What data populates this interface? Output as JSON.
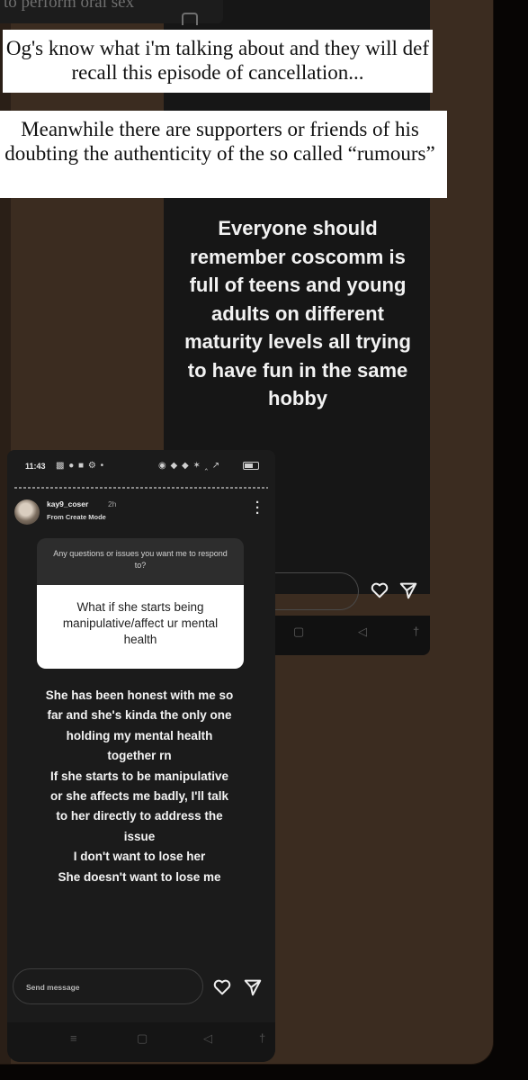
{
  "top_fragment_text": "to perform oral sex",
  "captions": [
    "Og's know what i'm talking about and they will def recall this episode of cancellation...",
    "Meanwhile there are supporters or friends of his doubting the authenticity of the so called “rumours”"
  ],
  "back_story": {
    "text": "Everyone should remember coscomm is full of teens and young adults on different maturity levels all trying to have fun in the same hobby",
    "icons": [
      "heart-icon",
      "send-icon"
    ],
    "nav": [
      "▢",
      "◁",
      "†"
    ]
  },
  "front_story": {
    "status": {
      "time": "11:43",
      "left_icons": "▩ ● ■ ⚙ •",
      "right_icons": "◉ ◆ ◆ ✶ ‸ ↗"
    },
    "username": "kay9_coser",
    "time_ago": "2h",
    "subtitle": "From Create Mode",
    "question_prompt": "Any questions or issues you want me to respond to?",
    "question_text": "What if she starts being manipulative/affect ur mental health",
    "reply_lines": [
      "She has been honest with me so",
      "far and she's kinda the only one",
      "holding my mental health",
      "together rn",
      "If she starts to be manipulative",
      "or she affects me badly, I'll talk",
      "to her directly to address the",
      "issue",
      "I don't want to lose her",
      "She doesn't want to lose me"
    ],
    "send_placeholder": "Send message",
    "nav": [
      "≡",
      "▢",
      "◁",
      "†"
    ]
  }
}
